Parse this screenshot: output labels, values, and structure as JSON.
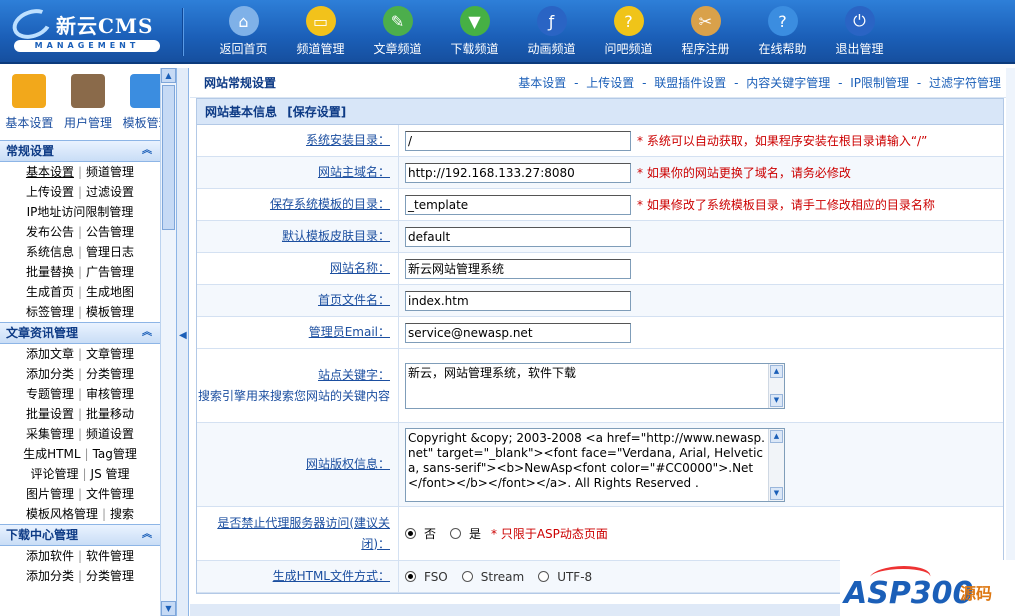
{
  "logo": {
    "name": "新云CMS",
    "sub": "MANAGEMENT"
  },
  "nav": [
    {
      "label": "返回首页",
      "icon": "home-icon",
      "color": "#7fb1e8"
    },
    {
      "label": "频道管理",
      "icon": "monitor-icon",
      "color": "#f2c21b"
    },
    {
      "label": "文章频道",
      "icon": "document-icon",
      "color": "#4cae4c"
    },
    {
      "label": "下载频道",
      "icon": "download-icon",
      "color": "#46b044"
    },
    {
      "label": "动画频道",
      "icon": "flash-icon",
      "color": "#2a64c4"
    },
    {
      "label": "问吧频道",
      "icon": "question-icon",
      "color": "#f0c419"
    },
    {
      "label": "程序注册",
      "icon": "tools-icon",
      "color": "#d9a14a"
    },
    {
      "label": "在线帮助",
      "icon": "help-icon",
      "color": "#3b8de0"
    },
    {
      "label": "退出管理",
      "icon": "power-icon",
      "color": "#2a64c4"
    }
  ],
  "sidebar": {
    "icons": [
      {
        "label": "基本设置",
        "icon": "gears-icon"
      },
      {
        "label": "用户管理",
        "icon": "user-icon"
      },
      {
        "label": "模板管理",
        "icon": "template-icon"
      }
    ],
    "groups": [
      {
        "title": "常规设置",
        "rows": [
          [
            "基本设置",
            "频道管理"
          ],
          [
            "上传设置",
            "过滤设置"
          ],
          [
            "IP地址访问限制管理"
          ],
          [
            "发布公告",
            "公告管理"
          ],
          [
            "系统信息",
            "管理日志"
          ],
          [
            "批量替换",
            "广告管理"
          ],
          [
            "生成首页",
            "生成地图"
          ],
          [
            "标签管理",
            "模板管理"
          ]
        ]
      },
      {
        "title": "文章资讯管理",
        "rows": [
          [
            "添加文章",
            "文章管理"
          ],
          [
            "添加分类",
            "分类管理"
          ],
          [
            "专题管理",
            "审核管理"
          ],
          [
            "批量设置",
            "批量移动"
          ],
          [
            "采集管理",
            "频道设置"
          ],
          [
            "生成HTML",
            "Tag管理"
          ],
          [
            "评论管理",
            "JS 管理"
          ],
          [
            "图片管理",
            "文件管理"
          ],
          [
            "模板风格管理",
            "搜索"
          ]
        ]
      },
      {
        "title": "下载中心管理",
        "rows": [
          [
            "添加软件",
            "软件管理"
          ],
          [
            "添加分类",
            "分类管理"
          ]
        ]
      }
    ]
  },
  "main": {
    "page_title": "网站常规设置",
    "top_links": [
      "基本设置",
      "上传设置",
      "联盟插件设置",
      "内容关键字管理",
      "IP限制管理",
      "过滤字符管理"
    ],
    "link_sep": " - ",
    "panel_title": "网站基本信息",
    "save_link": "[保存设置]",
    "fields": [
      {
        "label": "系统安装目录：",
        "value": "/",
        "note": "* 系统可以自动获取，如果程序安装在根目录请输入“/”"
      },
      {
        "label": "网站主域名：",
        "value": "http://192.168.133.27:8080",
        "note": "* 如果你的网站更换了域名，请务必修改"
      },
      {
        "label": "保存系统模板的目录：",
        "value": "_template",
        "note": "* 如果修改了系统模板目录，请手工修改相应的目录名称"
      },
      {
        "label": "默认模板皮肤目录：",
        "value": "default",
        "note": ""
      },
      {
        "label": "网站名称：",
        "value": "新云网站管理系统",
        "note": ""
      },
      {
        "label": "首页文件名：",
        "value": "index.htm",
        "note": ""
      },
      {
        "label": "管理员Email：",
        "value": "service@newasp.net",
        "note": ""
      }
    ],
    "keywords": {
      "label": "站点关键字：",
      "hint": "搜索引擎用来搜索您网站的关键内容",
      "value": "新云，网站管理系统，软件下载"
    },
    "copyright": {
      "label": "网站版权信息：",
      "value": "Copyright &copy; 2003-2008 <a href=\"http://www.newasp.net\" target=\"_blank\"><font face=\"Verdana, Arial, Helvetica, sans-serif\"><b>NewAsp<font color=\"#CC0000\">.Net</font></b></font></a>. All Rights Reserved ."
    },
    "proxy": {
      "label": "是否禁止代理服务器访问(建议关闭)：",
      "opt_no": "否",
      "opt_yes": "是",
      "note": "* 只限于ASP动态页面"
    },
    "html_mode": {
      "label": "生成HTML文件方式：",
      "options": [
        "FSO",
        "Stream",
        "UTF-8"
      ]
    }
  },
  "watermark": {
    "brand": "ASP300",
    "suffix": "源码"
  }
}
